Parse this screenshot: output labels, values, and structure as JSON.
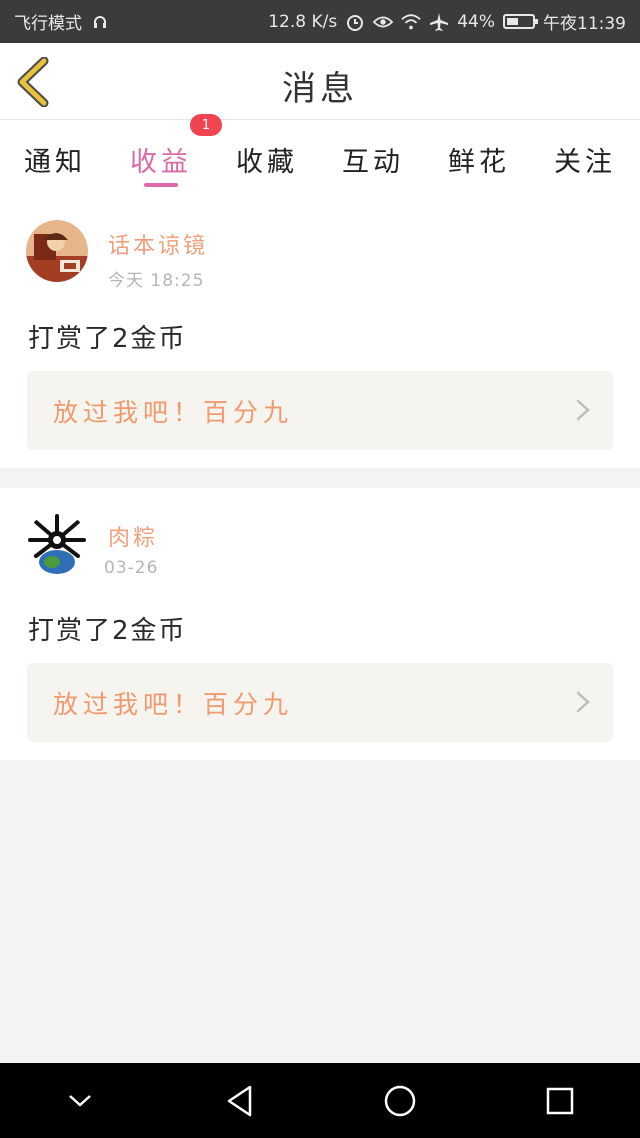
{
  "status_bar": {
    "mode": "飞行模式",
    "speed": "12.8 K/s",
    "battery": "44%",
    "battery_level": 0.44,
    "time": "午夜11:39"
  },
  "header": {
    "title": "消息"
  },
  "tabs": [
    {
      "label": "通知"
    },
    {
      "label": "收益",
      "active": true,
      "badge": "1"
    },
    {
      "label": "收藏"
    },
    {
      "label": "互动"
    },
    {
      "label": "鲜花"
    },
    {
      "label": "关注"
    }
  ],
  "messages": [
    {
      "username": "话本谅镜",
      "time": "今天 18:25",
      "text": "打赏了2金币",
      "quote": "放过我吧！百分九"
    },
    {
      "username": "肉粽",
      "time": "03-26",
      "text": "打赏了2金币",
      "quote": "放过我吧！百分九"
    }
  ],
  "colors": {
    "accent_tab": "#d96aa7",
    "username": "#f0a07a",
    "badge": "#f04450",
    "back_icon": "#e8c23a"
  }
}
